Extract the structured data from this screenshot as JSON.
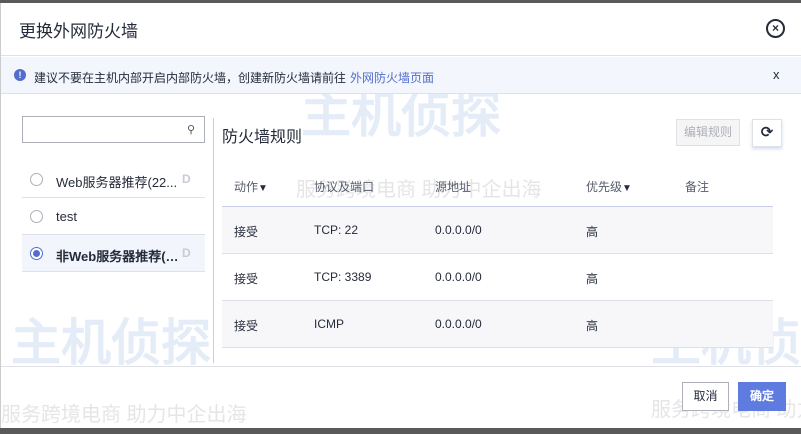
{
  "dialog": {
    "title": "更换外网防火墙",
    "close_icon": "close-circle-icon"
  },
  "alert": {
    "icon": "info-icon",
    "message": "建议不要在主机内部开启内部防火墙，创建新防火墙请前往",
    "link": "外网防火墙页面",
    "close": "x"
  },
  "sidebar": {
    "search_placeholder": "",
    "search_icon": "search-icon",
    "items": [
      {
        "label": "Web服务器推荐(22...",
        "badge": "D",
        "selected": false
      },
      {
        "label": "test",
        "badge": "",
        "selected": false
      },
      {
        "label": "非Web服务器推荐(2...",
        "badge": "D",
        "selected": true
      }
    ]
  },
  "rules": {
    "title": "防火墙规则",
    "edit_label": "编辑规则",
    "refresh_icon": "refresh-icon",
    "columns": [
      "动作",
      "协议及端口",
      "源地址",
      "优先级",
      "备注"
    ],
    "rows": [
      [
        "接受",
        "TCP: 22",
        "0.0.0.0/0",
        "高",
        ""
      ],
      [
        "接受",
        "TCP: 3389",
        "0.0.0.0/0",
        "高",
        ""
      ],
      [
        "接受",
        "ICMP",
        "0.0.0.0/0",
        "高",
        ""
      ]
    ]
  },
  "footer": {
    "cancel": "取消",
    "confirm": "确定"
  },
  "watermark": {
    "brand": "主机侦探",
    "slogan": "服务跨境电商 助力中企出海"
  },
  "colors": {
    "accent": "#5e7ce0",
    "link": "#526ecc"
  }
}
